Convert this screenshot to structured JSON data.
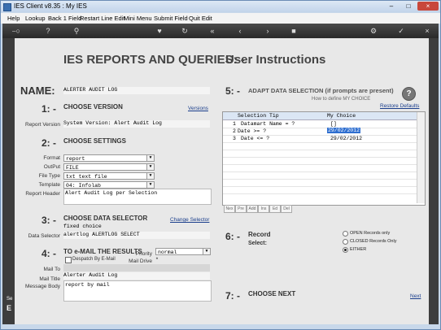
{
  "window": {
    "title": "IES Client v8.35 : My IES",
    "min": "–",
    "max": "□",
    "close": "×"
  },
  "menu": [
    "Help",
    "Lookup",
    "Back 1 Field",
    "Restart Line Edit",
    "Mini Menu",
    "Submit Field",
    "Quit Edit"
  ],
  "left_strip": [
    "Se",
    "E"
  ],
  "page": {
    "title": "IES REPORTS AND QUERIES: -",
    "subtitle": "User Instructions"
  },
  "name": {
    "label": "NAME:",
    "value": "ALERTER AUDIT LOG"
  },
  "s1": {
    "num": "1: -",
    "title": "CHOOSE VERSION",
    "link": "Versions",
    "field_label": "Report Version",
    "field_value": "System Version: Alert Audit Log"
  },
  "s2": {
    "num": "2: -",
    "title": "CHOOSE SETTINGS",
    "format_label": "Format",
    "format": "report",
    "output_label": "OutPut",
    "output": "FILE",
    "filetype_label": "File Type",
    "filetype": "txt text file",
    "template_label": "Template",
    "template": "04: Infolab",
    "header_label": "Report Header",
    "header": "Alert Audit Log per Selection"
  },
  "s3": {
    "num": "3: -",
    "title": "CHOOSE DATA SELECTOR",
    "link": "Change Selector",
    "fixed": "fixed choice",
    "label": "Data Selector",
    "value": "alertlog ALERTLOG SELECT"
  },
  "s4": {
    "num": "4: -",
    "title": "TO e-MAIL THE RESULTS",
    "priority_label": "Priority",
    "priority": "normal",
    "despatch": "Despatch By E-Mail",
    "maildrive_label": "Mail Drive",
    "maildrive": "*",
    "mailto_label": "Mail To",
    "mailtitle_label": "Mail Title",
    "mailtitle": "Alerter Audit Log",
    "mailbody_label": "Message Body",
    "mailbody": "report by mail"
  },
  "s5": {
    "num": "5: -",
    "title": "ADAPT DATA SELECTION (if prompts are present)",
    "howto": "How to define MY CHOICE",
    "restore": "Restore Defaults",
    "col_tip": "Selection Tip",
    "col_choice": "My Choice",
    "rows": [
      {
        "n": "1",
        "tip": "Datamart Name = ?",
        "choice": "[]"
      },
      {
        "n": "2",
        "tip": "Date >= ?",
        "choice": "29/02/2012"
      },
      {
        "n": "3",
        "tip": "Date <= ?",
        "choice": "29/02/2012"
      }
    ],
    "buttons": [
      "Nex",
      "Pre",
      "Add",
      "Ins",
      "Ed",
      "Del"
    ]
  },
  "s6": {
    "num": "6: -",
    "title": "Record",
    "title2": "Select:",
    "options": [
      "OPEN Records only",
      "CLOSED Records Only",
      "EITHER"
    ],
    "selected": 2
  },
  "s7": {
    "num": "7: -",
    "title": "CHOOSE NEXT",
    "link": "Next"
  }
}
